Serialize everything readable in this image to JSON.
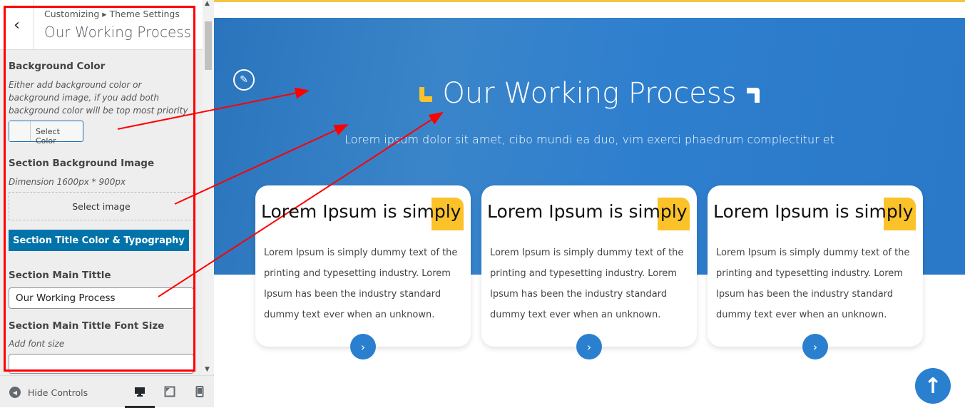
{
  "sidebar": {
    "breadcrumb": "Customizing ▸ Theme Settings",
    "title": "Our Working Process",
    "bg_color_label": "Background Color",
    "bg_color_desc": "Either add background color or background image, if you add both background color will be top most priority",
    "select_color": "Select Color",
    "bg_image_label": "Section Background Image",
    "bg_image_desc": "Dimension 1600px * 900px",
    "select_image": "Select image",
    "typography_button": "Section Title Color & Typography",
    "main_title_label": "Section Main Tittle",
    "main_title_value": "Our Working Process",
    "font_size_label": "Section Main Tittle Font Size",
    "font_size_desc": "Add font size",
    "font_size_value": "",
    "hide_controls": "Hide Controls"
  },
  "preview": {
    "title": "Our Working Process",
    "subtitle": "Lorem ipsum dolor sit amet, cibo mundi ea duo, vim exerci phaedrum complectitur et",
    "cards": [
      {
        "title": "Lorem Ipsum is simply",
        "text": "Lorem Ipsum is simply dummy text of the printing and typesetting industry. Lorem Ipsum has been the industry standard dummy text ever when an unknown."
      },
      {
        "title": "Lorem Ipsum is simply",
        "text": "Lorem Ipsum is simply dummy text of the printing and typesetting industry. Lorem Ipsum has been the industry standard dummy text ever when an unknown."
      },
      {
        "title": "Lorem Ipsum is simply",
        "text": "Lorem Ipsum is simply dummy text of the printing and typesetting industry. Lorem Ipsum has been the industry standard dummy text ever when an unknown."
      }
    ]
  },
  "colors": {
    "accent": "#2a7fcf",
    "highlight": "#fcc22a",
    "annotation": "#ff0000",
    "wp_blue": "#0073aa"
  }
}
